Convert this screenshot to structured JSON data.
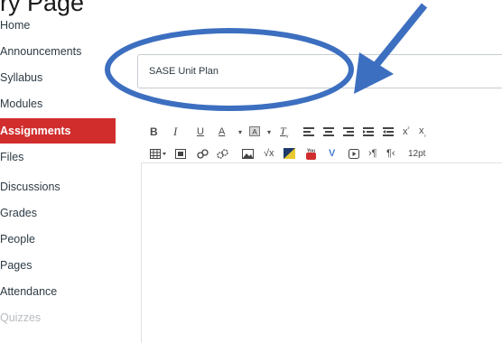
{
  "header": {
    "caption": "ry Page"
  },
  "sidebar": {
    "items": [
      {
        "label": "Home",
        "state": "normal"
      },
      {
        "label": "Announcements",
        "state": "normal"
      },
      {
        "label": "Syllabus",
        "state": "normal"
      },
      {
        "label": "Modules",
        "state": "normal"
      },
      {
        "label": "Assignments",
        "state": "active"
      },
      {
        "label": "Files",
        "state": "normal"
      },
      {
        "label": "Discussions",
        "state": "normal"
      },
      {
        "label": "Grades",
        "state": "normal"
      },
      {
        "label": "People",
        "state": "normal"
      },
      {
        "label": "Pages",
        "state": "normal"
      },
      {
        "label": "Attendance",
        "state": "normal"
      },
      {
        "label": "Quizzes",
        "state": "disabled"
      }
    ]
  },
  "form": {
    "title_value": "SASE Unit Plan"
  },
  "toolbar": {
    "font_size": "12pt",
    "row1_icons": [
      "bold-icon",
      "italic-icon",
      "underline-icon",
      "text-color-icon",
      "background-color-icon",
      "clear-formatting-icon",
      "align-left-icon",
      "align-center-icon",
      "align-right-icon",
      "indent-icon",
      "outdent-icon",
      "superscript-icon",
      "subscript-icon"
    ],
    "row2_icons": [
      "table-icon",
      "media-icon",
      "link-icon",
      "unlink-icon",
      "image-icon",
      "math-icon",
      "kaltura-icon",
      "youtube-icon",
      "vimeo-icon",
      "record-icon",
      "ltr-icon",
      "rtl-icon"
    ]
  },
  "colors": {
    "accent": "#d12d2d",
    "annotation": "#3d6fc0",
    "text": "#2d3b45"
  }
}
